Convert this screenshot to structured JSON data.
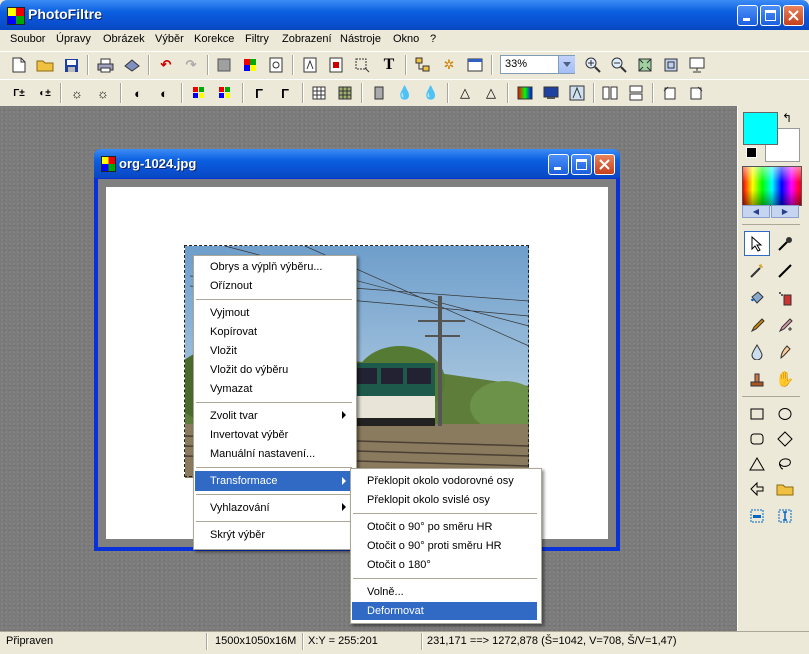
{
  "app": {
    "title": "PhotoFiltre"
  },
  "menubar": [
    "Soubor",
    "Úpravy",
    "Obrázek",
    "Výběr",
    "Korekce",
    "Filtry",
    "Zobrazení",
    "Nástroje",
    "Okno",
    "?"
  ],
  "toolbar": {
    "zoom_value": "33%"
  },
  "document": {
    "title": "org-1024.jpg"
  },
  "context_menu": {
    "items": [
      "Obrys a výplň výběru...",
      "Oříznout",
      "Vyjmout",
      "Kopírovat",
      "Vložit",
      "Vložit do výběru",
      "Vymazat",
      "Zvolit tvar",
      "Invertovat výběr",
      "Manuální nastavení...",
      "Transformace",
      "Vyhlazování",
      "Skrýt výběr"
    ],
    "highlighted": "Transformace"
  },
  "submenu": {
    "items": [
      "Překlopit okolo vodorovné osy",
      "Překlopit okolo svislé osy",
      "Otočit o 90° po směru HR",
      "Otočit o 90° proti směru HR",
      "Otočit o 180°",
      "Volně...",
      "Deformovat"
    ],
    "highlighted": "Deformovat"
  },
  "statusbar": {
    "status": "Připraven",
    "image_info": "1500x1050x16M",
    "coords": "X:Y = 255:201",
    "selection_info": "231,171 ==> 1272,878 (Š=1042, V=708, Š/V=1,47)"
  },
  "colors": {
    "foreground": "#00ffff",
    "background": "#ffffff",
    "titlebar": "#0a5fe0",
    "highlight": "#316ac5"
  }
}
